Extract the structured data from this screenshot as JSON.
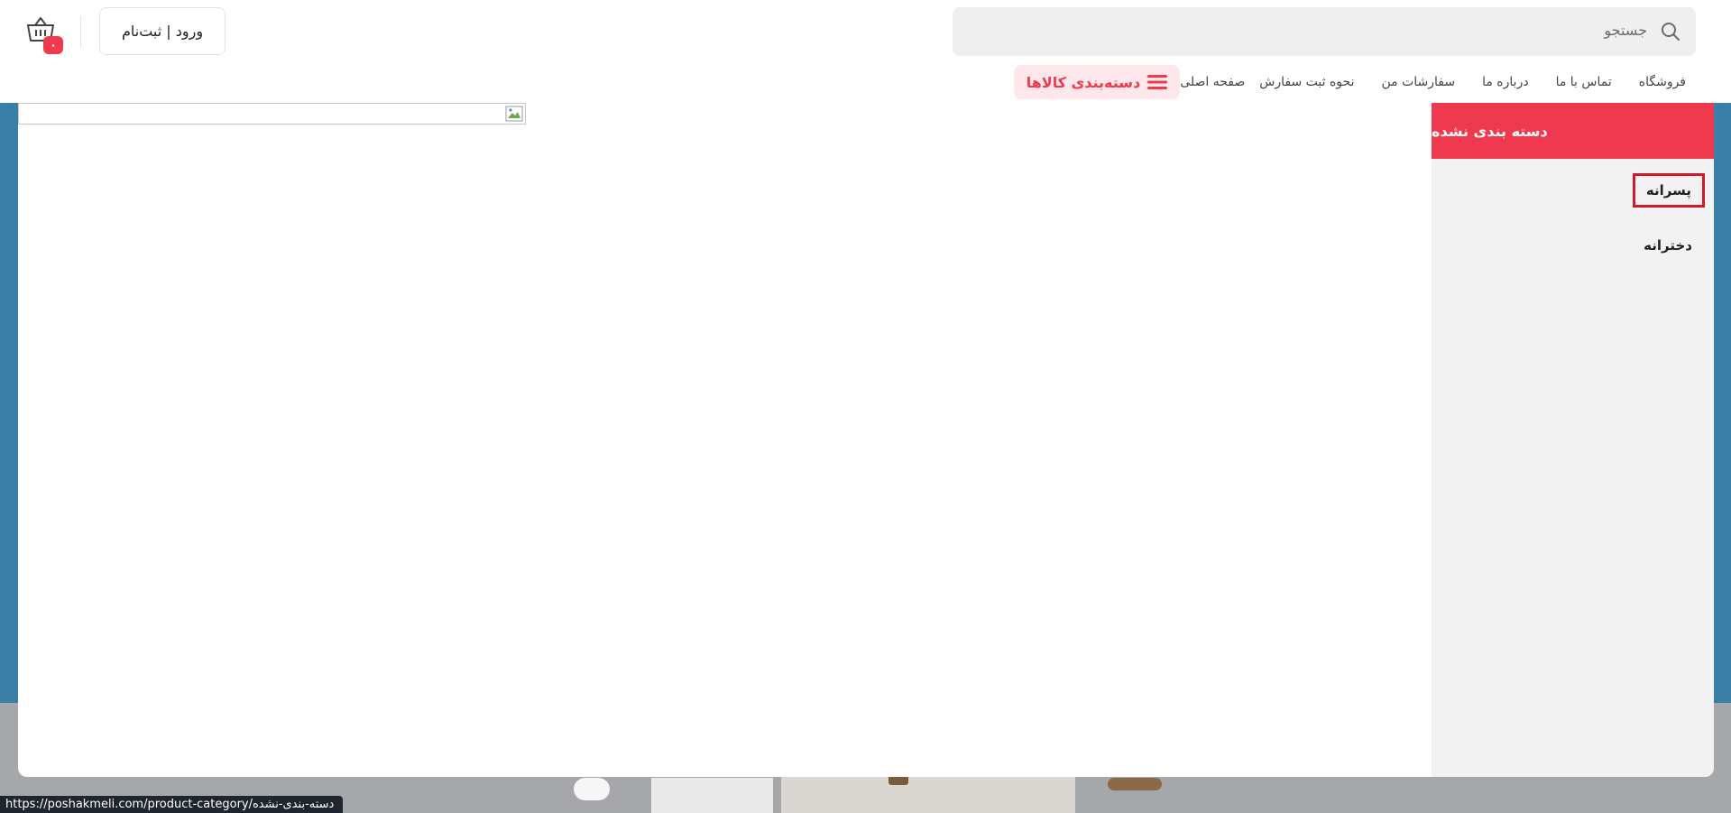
{
  "header": {
    "search": {
      "placeholder": "جستجو"
    },
    "login_label": "ورود | ثبت‌نام",
    "cart_count": "۰"
  },
  "nav": {
    "category_label": "دسته‌بندی کالاها",
    "items": [
      {
        "label": "صفحه اصلی"
      },
      {
        "label": "نحوه ثبت سفارش"
      },
      {
        "label": "سفارشات من"
      },
      {
        "label": "درباره ما"
      },
      {
        "label": "تماس با ما"
      },
      {
        "label": "فروشگاه"
      }
    ]
  },
  "mega_menu": {
    "sidebar_heading": "دسته بندی نشده",
    "items": [
      {
        "label": "پسرانه"
      },
      {
        "label": "دخترانه"
      }
    ]
  },
  "status_bar": {
    "url": "https://poshakmeli.com/product-category/دسته-بندی-نشده"
  },
  "colors": {
    "accent": "#ef394e",
    "accent_light": "#fde7eb",
    "status_bg": "#1f2630",
    "hero_bg": "#3a7fa6"
  }
}
